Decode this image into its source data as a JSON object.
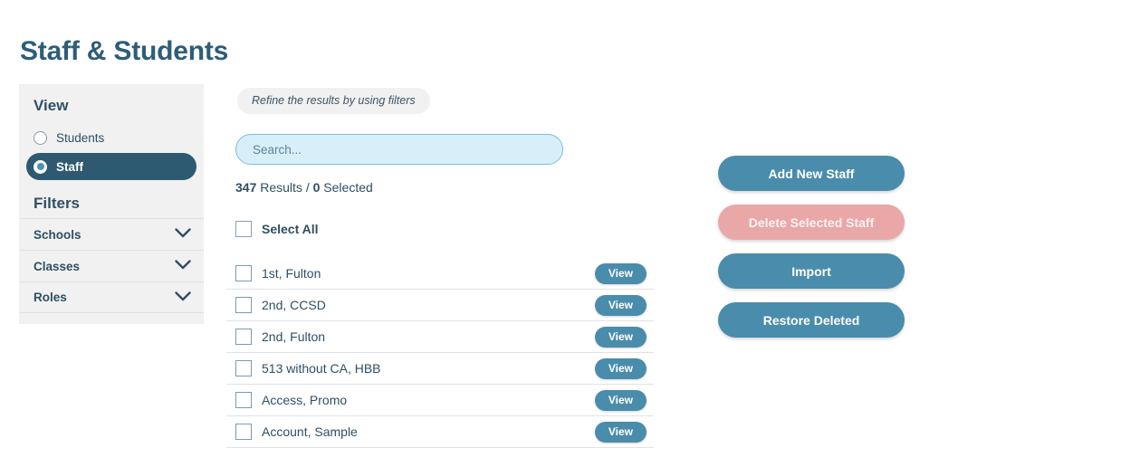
{
  "page": {
    "title": "Staff & Students"
  },
  "sidebar": {
    "view_heading": "View",
    "view_options": [
      {
        "label": "Students",
        "selected": false
      },
      {
        "label": "Staff",
        "selected": true
      }
    ],
    "filters_heading": "Filters",
    "filters": [
      {
        "label": "Schools",
        "icon": "chevron-down-icon"
      },
      {
        "label": "Classes",
        "icon": "chevron-down-icon"
      },
      {
        "label": "Roles",
        "icon": "chevron-down-icon"
      }
    ]
  },
  "main": {
    "refine_hint": "Refine the results by using filters",
    "search": {
      "placeholder": "Search...",
      "value": ""
    },
    "results": {
      "count": "347",
      "count_label": "Results",
      "separator": "/",
      "selected_count": "0",
      "selected_label": "Selected"
    },
    "select_all_label": "Select All",
    "view_button_label": "View",
    "rows": [
      {
        "name": "1st, Fulton",
        "checked": false
      },
      {
        "name": "2nd, CCSD",
        "checked": false
      },
      {
        "name": "2nd, Fulton",
        "checked": false
      },
      {
        "name": "513 without CA, HBB",
        "checked": false
      },
      {
        "name": "Access, Promo",
        "checked": false
      },
      {
        "name": "Account, Sample",
        "checked": false
      }
    ]
  },
  "actions": [
    {
      "label": "Add New Staff",
      "style": "primary"
    },
    {
      "label": "Delete Selected Staff",
      "style": "danger-disabled"
    },
    {
      "label": "Import",
      "style": "primary"
    },
    {
      "label": "Restore Deleted",
      "style": "primary"
    }
  ],
  "colors": {
    "title": "#2d5d78",
    "primary_button": "#4a8cab",
    "danger_button": "#e9a7a8",
    "selected_pill": "#2d5a70",
    "panel_bg": "#f1f1f1",
    "search_bg": "#d8eff9",
    "search_border": "#77c0dc",
    "text": "#2f4f63"
  }
}
